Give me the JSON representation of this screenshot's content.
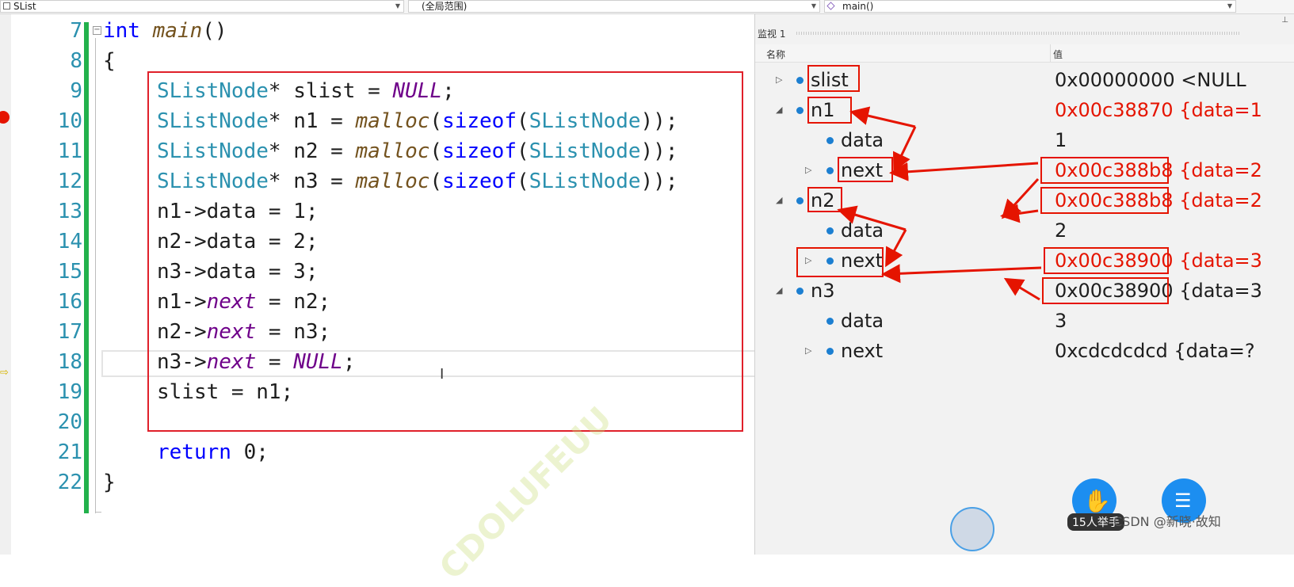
{
  "navbar": {
    "project": "SList",
    "scope": "(全局范围)",
    "function": "main()"
  },
  "editor": {
    "line_numbers": [
      "7",
      "8",
      "9",
      "10",
      "11",
      "12",
      "13",
      "14",
      "15",
      "16",
      "17",
      "18",
      "19",
      "20",
      "21",
      "22"
    ],
    "lines": {
      "l7_kw": "int",
      "l7_fn": "main",
      "l7_rest": "()",
      "l8": "{",
      "l9_type": "SListNode",
      "l9_mid": "* slist = ",
      "l9_mac": "NULL",
      "l9_end": ";",
      "l10_type": "SListNode",
      "l10_mid": "* n1 = ",
      "l11_type": "SListNode",
      "l11_mid": "* n2 = ",
      "l12_type": "SListNode",
      "l12_mid": "* n3 = ",
      "malloc": "malloc",
      "paren_open": "(",
      "sizeof": "sizeof",
      "sizeof_type": "SListNode",
      "paren_close": "));",
      "l13": "n1->data = 1;",
      "l14": "n2->data = 2;",
      "l15": "n3->data = 3;",
      "l16_a": "n1->",
      "l16_next": "next",
      "l16_b": " = n2;",
      "l17_a": "n2->",
      "l17_next": "next",
      "l17_b": " = n3;",
      "l18_a": "n3->",
      "l18_next": "next",
      "l18_b": " = ",
      "l18_null": "NULL",
      "l18_end": ";",
      "l19": "slist = n1;",
      "l21_kw": "return",
      "l21_rest": " 0;",
      "l22": "}"
    },
    "watermark": "CDOLUFEUU"
  },
  "watch": {
    "title": "监视 1",
    "col_name": "名称",
    "col_value": "值",
    "rows": [
      {
        "name": "slist",
        "value": "0x00000000 <NULL"
      },
      {
        "name": "n1",
        "value": "0x00c38870 {data=1"
      },
      {
        "name": "data",
        "value": "1"
      },
      {
        "name": "next",
        "value_addr": "0x00c388b8",
        "value_rest": " {data=2"
      },
      {
        "name": "n2",
        "value_addr": "0x00c388b8",
        "value_rest": " {data=2"
      },
      {
        "name": "data",
        "value": "2"
      },
      {
        "name": "next",
        "value_addr": "0x00c38900",
        "value_rest": " {data=3"
      },
      {
        "name": "n3",
        "value_addr": "0x00c38900",
        "value_rest": " {data=3"
      },
      {
        "name": "data",
        "value": "3"
      },
      {
        "name": "next",
        "value": "0xcdcdcdcd {data=?"
      }
    ]
  },
  "overlay": {
    "hand_badge": "15人举手",
    "csdn": "CSDN @新晓·故知"
  },
  "colors": {
    "accent_red": "#e51400",
    "change_bar": "#22b14c",
    "fab_blue": "#1c8ef0"
  }
}
